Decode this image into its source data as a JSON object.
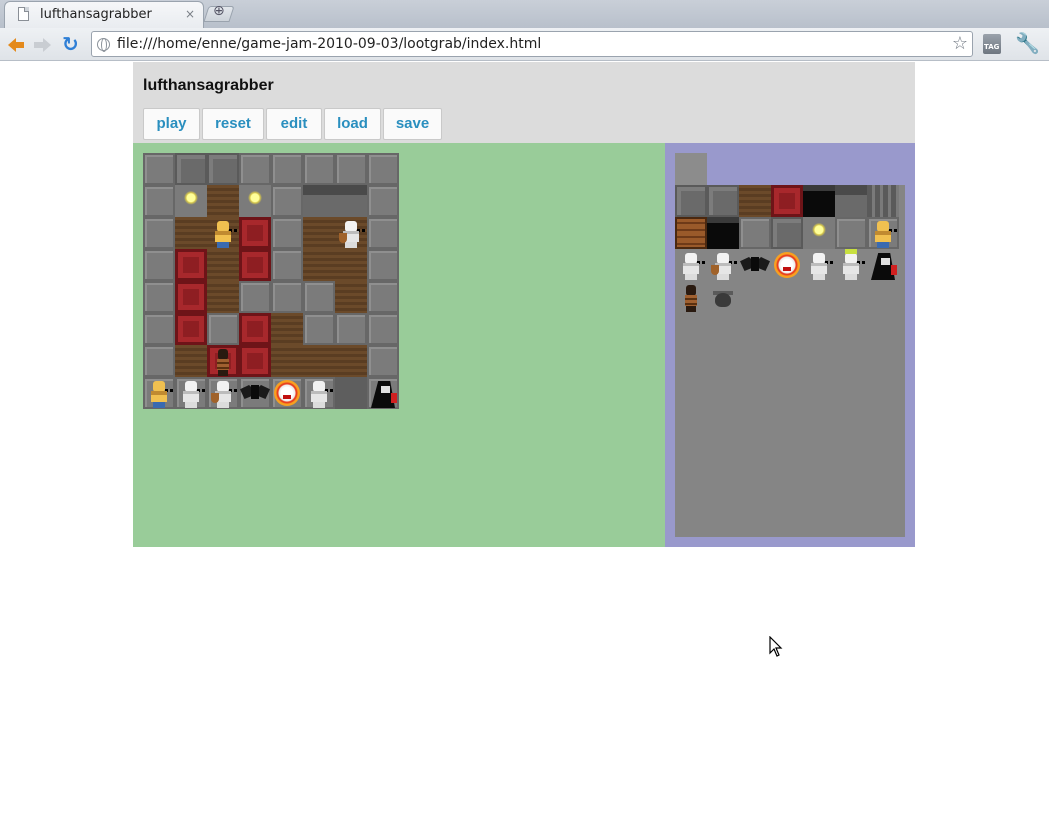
{
  "browser": {
    "tab_title": "lufthansagrabber",
    "tab_close": "×",
    "new_tab": "⊕",
    "url": "file:///home/enne/game-jam-2010-09-03/lootgrab/index.html",
    "icons": [
      "back-arrow-icon",
      "forward-arrow-icon",
      "reload-icon",
      "globe-icon",
      "star-icon",
      "tag-icon",
      "wrench-icon"
    ]
  },
  "page": {
    "title": "lufthansagrabber",
    "buttons": {
      "play": "play",
      "reset": "reset",
      "edit": "edit",
      "load": "load",
      "save": "save"
    }
  },
  "colors": {
    "header_bg": "#dcdcdc",
    "game_bg": "#99cc99",
    "panel_bg": "#9999cc",
    "button_text": "#2a8fbf"
  },
  "board": {
    "rows": [
      [
        "stone",
        "stone2",
        "stone2",
        "stone",
        "stone",
        "stone",
        "stone",
        "stone"
      ],
      [
        "stone",
        "lamp",
        "floor",
        "lamp",
        "stone",
        "wall",
        "wall",
        "stone"
      ],
      [
        "stone",
        "floor",
        "floor",
        "carpet",
        "stone",
        "floor",
        "floor",
        "stone"
      ],
      [
        "stone",
        "carpet",
        "floor",
        "carpet",
        "stone",
        "floor",
        "floor",
        "stone"
      ],
      [
        "stone",
        "carpet",
        "floor",
        "stone",
        "stone",
        "stone",
        "floor",
        "stone"
      ],
      [
        "stone",
        "carpet",
        "stone",
        "carpet",
        "floor",
        "stone",
        "stone",
        "stone"
      ],
      [
        "stone",
        "floor",
        "carpet",
        "carpet",
        "floor",
        "floor",
        "floor",
        "stone"
      ],
      [
        "stone",
        "floor",
        "floor",
        "carpet",
        "floor",
        "floor",
        "floor",
        "stone"
      ]
    ],
    "units": [
      {
        "sprite": "thief",
        "col": 2,
        "row": 2
      },
      {
        "sprite": "skeleton-shield",
        "col": 6,
        "row": 2
      },
      {
        "sprite": "barrel",
        "col": 2,
        "row": 6
      }
    ],
    "roster": [
      "thief",
      "skeleton",
      "skeleton-shield",
      "bat",
      "fire-skull",
      "skeleton-walker",
      "empty",
      "reaper"
    ]
  },
  "palette": {
    "tiles_row1": [
      "stone2",
      "stone2",
      "floor",
      "carpet",
      "black",
      "wall",
      "stairs"
    ],
    "tiles_row2": [
      "crate",
      "black",
      "stone",
      "stone2",
      "lamp",
      "stone",
      "thief"
    ],
    "sprites_row3": [
      "skeleton",
      "skeleton-shield",
      "bat",
      "fire-skull",
      "skeleton-walker",
      "skeleton-crown",
      "reaper"
    ],
    "sprites_row4": [
      "barrel",
      "pot"
    ]
  }
}
